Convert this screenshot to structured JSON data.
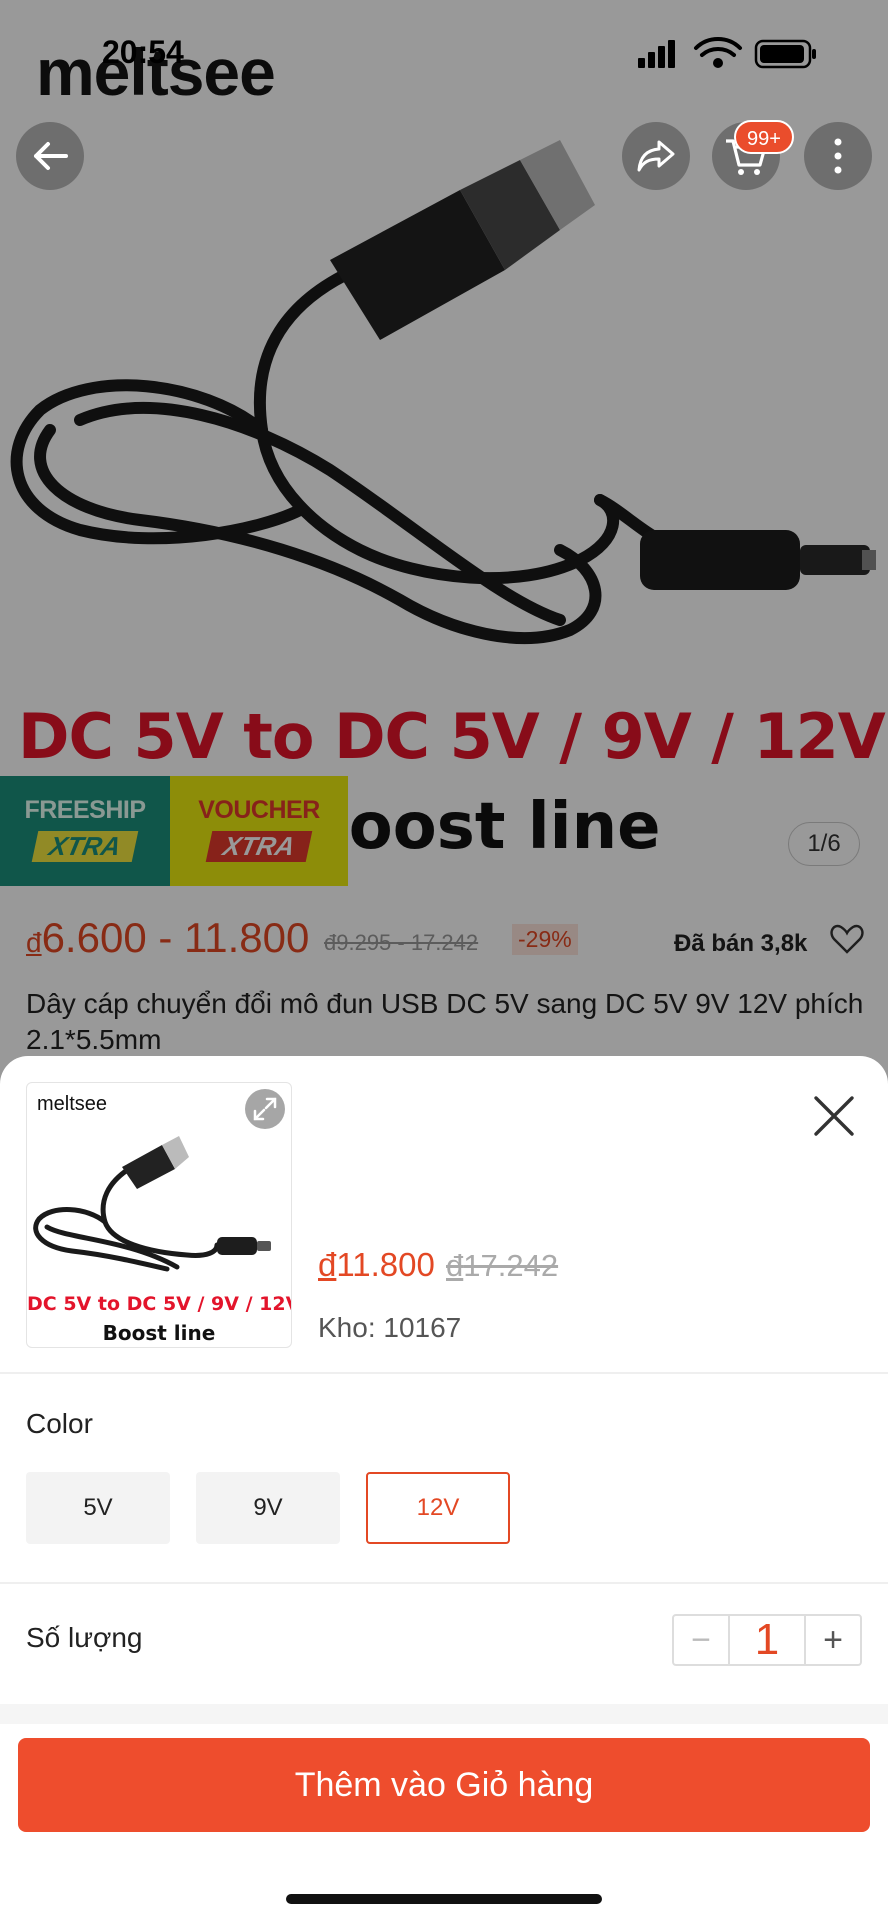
{
  "status_bar": {
    "time": "20:54"
  },
  "hero": {
    "brand": "meltsee",
    "line1": "DC 5V to DC 5V / 9V / 12V",
    "line2": "Boost line",
    "badge_freeship_top": "FREESHIP",
    "badge_freeship_bottom": "XTRA",
    "badge_voucher_top": "VOUCHER",
    "badge_voucher_bottom": "XTRA",
    "page_indicator": "1/6"
  },
  "nav": {
    "cart_badge": "99+"
  },
  "product": {
    "currency": "đ",
    "price_range": "6.600 - 11.800",
    "old_price_range": "đ9.295 - 17.242",
    "discount": "-29%",
    "sold": "Đã bán 3,8k",
    "title": "Dây cáp chuyển đổi mô đun USB DC 5V sang DC 5V 9V 12V phích 2.1*5.5mm"
  },
  "sheet": {
    "thumb_brand": "meltsee",
    "thumb_line1": "DC 5V to DC 5V / 9V / 12V",
    "thumb_line2": "Boost line",
    "currency": "đ",
    "price": "11.800",
    "old_price": "17.242",
    "stock": "Kho: 10167",
    "color_label": "Color",
    "variants": [
      "5V",
      "9V",
      "12V"
    ],
    "selected_variant": "12V",
    "quantity_label": "Số lượng",
    "quantity": "1",
    "qty_minus": "−",
    "qty_plus": "+",
    "add_to_cart": "Thêm vào Giỏ hàng"
  },
  "colors": {
    "accent": "#ee4d2d",
    "price": "#e34824"
  }
}
